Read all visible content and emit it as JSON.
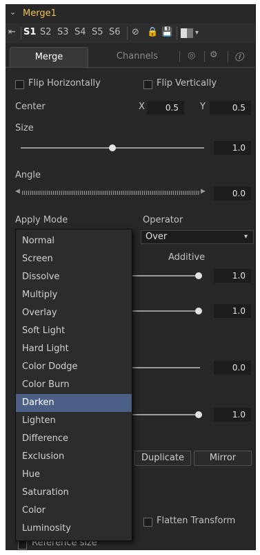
{
  "node": {
    "title": "Merge1",
    "collapse_glyph": "⌄"
  },
  "toolbar": {
    "pin_icon": "pin-icon",
    "slots": [
      "S1",
      "S2",
      "S3",
      "S4",
      "S5",
      "S6"
    ],
    "active_slot": "S1"
  },
  "tabs": [
    {
      "label": "Merge",
      "active": true
    },
    {
      "label": "Channels",
      "active": false
    }
  ],
  "controls": {
    "flip_h": "Flip Horizontally",
    "flip_v": "Flip Vertically",
    "center_label": "Center",
    "center_x_label": "X",
    "center_x": "0.5",
    "center_y_label": "Y",
    "center_y": "0.5",
    "size_label": "Size",
    "size_value": "1.0",
    "size_level": 0.5,
    "angle_label": "Angle",
    "angle_value": "0.0",
    "apply_mode_label": "Apply Mode",
    "operator_label": "Operator",
    "operator_value": "Over",
    "additive_label": "Additive",
    "slider_values": [
      "1.0",
      "1.0",
      "0.0",
      "1.0"
    ],
    "duplicate_button": "Duplicate",
    "mirror_button": "Mirror",
    "flatten_transform": "Flatten Transform",
    "reference_size": "Reference size"
  },
  "dropdown": {
    "items": [
      "Normal",
      "Screen",
      "Dissolve",
      "Multiply",
      "Overlay",
      "Soft Light",
      "Hard Light",
      "Color Dodge",
      "Color Burn",
      "Darken",
      "Lighten",
      "Difference",
      "Exclusion",
      "Hue",
      "Saturation",
      "Color",
      "Luminosity"
    ],
    "highlighted": "Darken"
  },
  "colors": {
    "title": "#f2c14e",
    "highlight": "#4c5f85",
    "panel": "#282828"
  }
}
